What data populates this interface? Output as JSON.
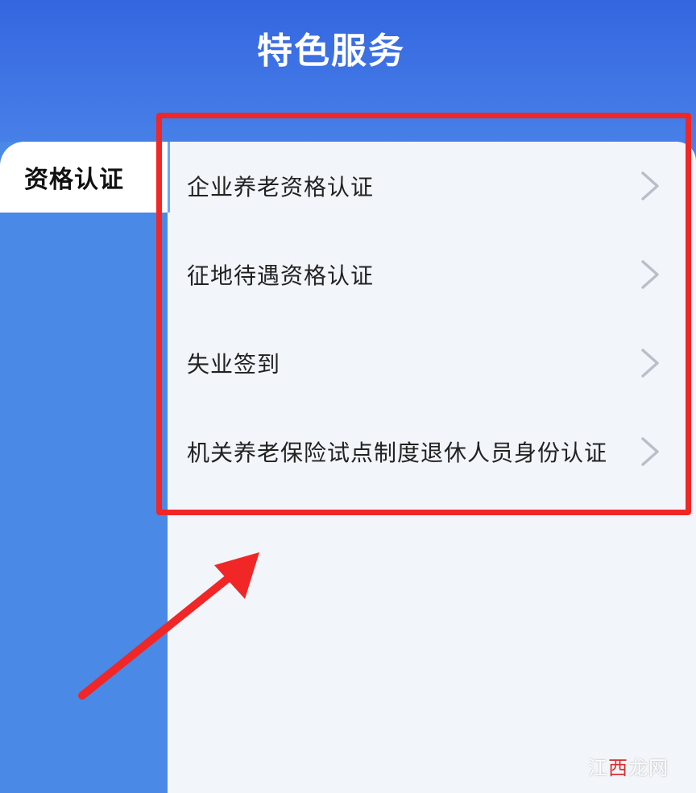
{
  "header": {
    "title": "特色服务"
  },
  "sidebar": {
    "items": [
      {
        "label": "资格认证",
        "active": true
      }
    ]
  },
  "content": {
    "items": [
      {
        "label": "企业养老资格认证"
      },
      {
        "label": "征地待遇资格认证"
      },
      {
        "label": "失业签到"
      },
      {
        "label": "机关养老保险试点制度退休人员身份认证"
      }
    ]
  },
  "annotation": {
    "highlight_color": "#f12626"
  },
  "watermark": {
    "part1": "江",
    "part2": "西",
    "part3": "龙网"
  },
  "colors": {
    "brand_blue": "#3a6fe4",
    "sidebar_blue": "#4a89e6",
    "panel_bg": "#f2f5fa"
  }
}
